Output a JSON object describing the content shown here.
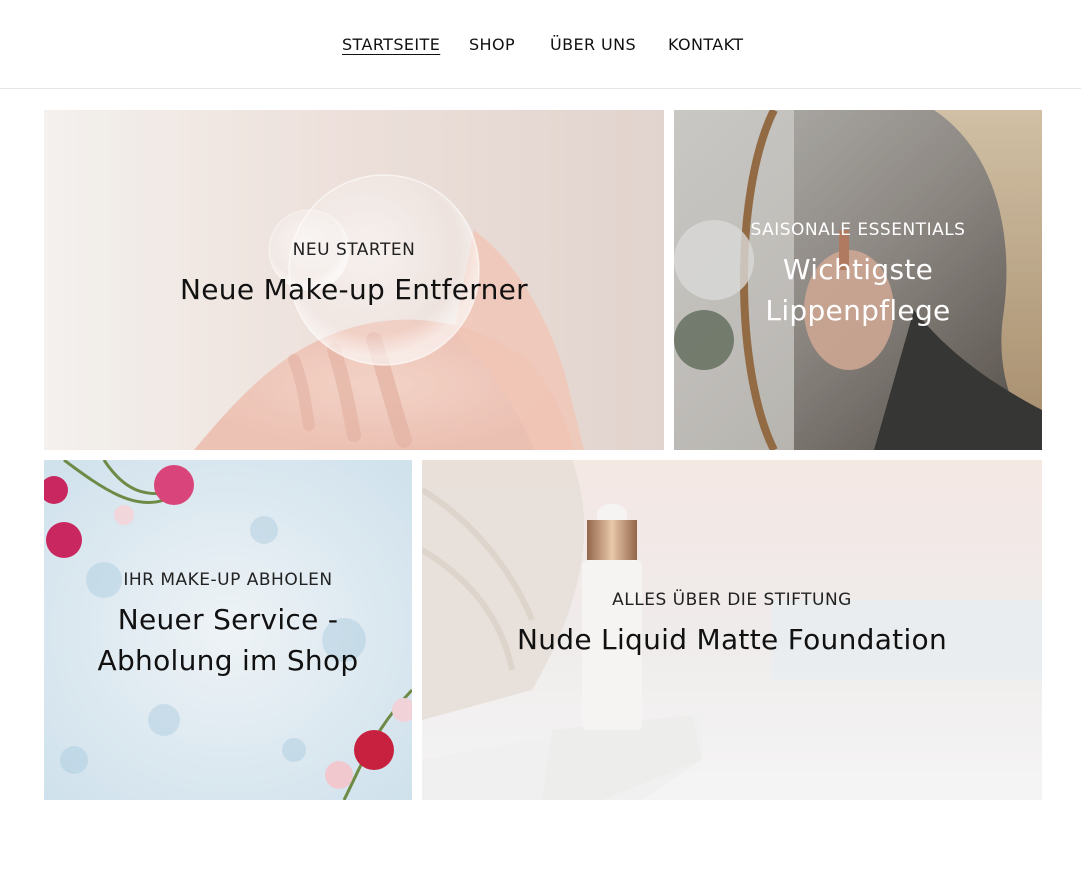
{
  "nav": {
    "items": [
      {
        "label": "STARTSEITE",
        "active": true
      },
      {
        "label": "SHOP",
        "active": false
      },
      {
        "label": "ÜBER UNS",
        "active": false
      },
      {
        "label": "KONTAKT",
        "active": false
      }
    ]
  },
  "tiles": [
    {
      "kicker": "NEU STARTEN",
      "headline": "Neue Make-up Entferner",
      "image": "hand-with-soap-bubble"
    },
    {
      "kicker": "SAISONALE ESSENTIALS",
      "headline_line1": "Wichtigste",
      "headline_line2": "Lippenpflege",
      "image": "woman-applying-lipstick-mirror"
    },
    {
      "kicker": "IHR MAKE-UP ABHOLEN",
      "headline_line1": "Neuer Service -",
      "headline_line2": "Abholung im Shop",
      "image": "pink-flowers-on-blue-background"
    },
    {
      "kicker": "ALLES ÜBER DIE STIFTUNG",
      "headline": "Nude Liquid Matte Foundation",
      "image": "white-dropper-bottle-on-marble"
    }
  ],
  "colors": {
    "accent_text": "#111111",
    "overlay_text_light": "#ffffff",
    "divider": "#e6e6e6"
  }
}
